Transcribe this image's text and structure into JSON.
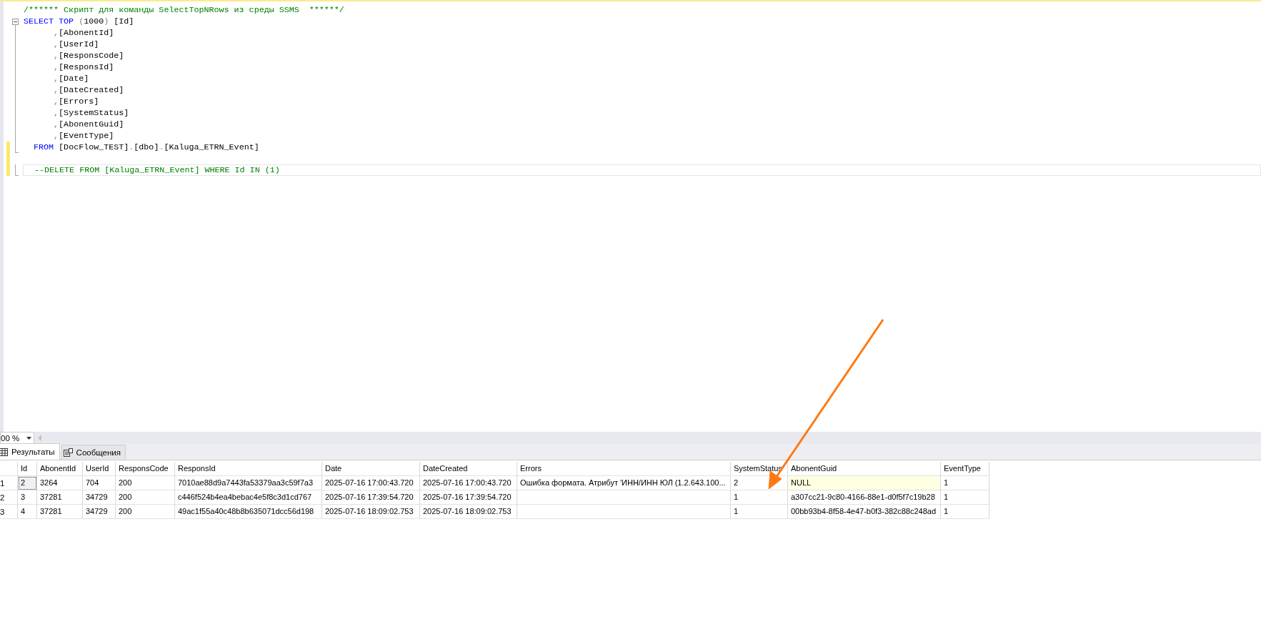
{
  "editor": {
    "lines": [
      {
        "changed": false,
        "current": false,
        "kind": "none",
        "tokens": [
          {
            "kind": "comment",
            "text": "/****** Скрипт для команды SelectTopNRows из среды SSMS  ******/"
          }
        ]
      },
      {
        "changed": false,
        "current": false,
        "kind": "start",
        "tokens": [
          {
            "kind": "keyword",
            "text": "SELECT TOP "
          },
          {
            "kind": "punct",
            "text": "("
          },
          {
            "kind": "plain",
            "text": "1000"
          },
          {
            "kind": "punct",
            "text": ")"
          },
          {
            "kind": "plain",
            "text": " [Id]"
          }
        ]
      },
      {
        "changed": false,
        "current": false,
        "kind": "inside",
        "tokens": [
          {
            "kind": "punct",
            "text": "      ,"
          },
          {
            "kind": "plain",
            "text": "[AbonentId]"
          }
        ]
      },
      {
        "changed": false,
        "current": false,
        "kind": "inside",
        "tokens": [
          {
            "kind": "punct",
            "text": "      ,"
          },
          {
            "kind": "plain",
            "text": "[UserId]"
          }
        ]
      },
      {
        "changed": false,
        "current": false,
        "kind": "inside",
        "tokens": [
          {
            "kind": "punct",
            "text": "      ,"
          },
          {
            "kind": "plain",
            "text": "[ResponsCode]"
          }
        ]
      },
      {
        "changed": false,
        "current": false,
        "kind": "inside",
        "tokens": [
          {
            "kind": "punct",
            "text": "      ,"
          },
          {
            "kind": "plain",
            "text": "[ResponsId]"
          }
        ]
      },
      {
        "changed": false,
        "current": false,
        "kind": "inside",
        "tokens": [
          {
            "kind": "punct",
            "text": "      ,"
          },
          {
            "kind": "plain",
            "text": "[Date]"
          }
        ]
      },
      {
        "changed": false,
        "current": false,
        "kind": "inside",
        "tokens": [
          {
            "kind": "punct",
            "text": "      ,"
          },
          {
            "kind": "plain",
            "text": "[DateCreated]"
          }
        ]
      },
      {
        "changed": false,
        "current": false,
        "kind": "inside",
        "tokens": [
          {
            "kind": "punct",
            "text": "      ,"
          },
          {
            "kind": "plain",
            "text": "[Errors]"
          }
        ]
      },
      {
        "changed": false,
        "current": false,
        "kind": "inside",
        "tokens": [
          {
            "kind": "punct",
            "text": "      ,"
          },
          {
            "kind": "plain",
            "text": "[SystemStatus]"
          }
        ]
      },
      {
        "changed": false,
        "current": false,
        "kind": "inside",
        "tokens": [
          {
            "kind": "punct",
            "text": "      ,"
          },
          {
            "kind": "plain",
            "text": "[AbonentGuid]"
          }
        ]
      },
      {
        "changed": false,
        "current": false,
        "kind": "inside",
        "tokens": [
          {
            "kind": "punct",
            "text": "      ,"
          },
          {
            "kind": "plain",
            "text": "[EventType]"
          }
        ]
      },
      {
        "changed": true,
        "current": false,
        "kind": "end",
        "tokens": [
          {
            "kind": "keyword",
            "text": "  FROM "
          },
          {
            "kind": "plain",
            "text": "[DocFlow_TEST]"
          },
          {
            "kind": "punct",
            "text": "."
          },
          {
            "kind": "plain",
            "text": "[dbo]"
          },
          {
            "kind": "punct",
            "text": "."
          },
          {
            "kind": "plain",
            "text": "[Kaluga_ETRN_Event]"
          }
        ]
      },
      {
        "changed": true,
        "kind": "none"
      },
      {
        "changed": true,
        "current": true,
        "kind": "single",
        "tokens": [
          {
            "kind": "comment",
            "text": "  --DELETE FROM [Kaluga_ETRN_Event] WHERE Id IN (1)"
          }
        ]
      }
    ]
  },
  "zoom": {
    "value": "00 %"
  },
  "tabs": [
    {
      "label": "Результаты",
      "selected": true
    },
    {
      "label": "Сообщения",
      "selected": false
    }
  ],
  "grid": {
    "columns": [
      "Id",
      "AbonentId",
      "UserId",
      "ResponsCode",
      "ResponsId",
      "Date",
      "DateCreated",
      "Errors",
      "SystemStatus",
      "AbonentGuid",
      "EventType"
    ],
    "rows": [
      {
        "number": "1",
        "cells": [
          {
            "text": "2",
            "selected": true,
            "null": false
          },
          {
            "text": "3264",
            "selected": false,
            "null": false
          },
          {
            "text": "704",
            "selected": false,
            "null": false
          },
          {
            "text": "200",
            "selected": false,
            "null": false
          },
          {
            "text": "7010ae88d9a7443fa53379aa3c59f7a3",
            "selected": false,
            "null": false
          },
          {
            "text": "2025-07-16 17:00:43.720",
            "selected": false,
            "null": false
          },
          {
            "text": "2025-07-16 17:00:43.720",
            "selected": false,
            "null": false
          },
          {
            "text": "Ошибка формата. Атрибут 'ИНН/ИНН ЮЛ (1.2.643.100...",
            "selected": false,
            "null": false
          },
          {
            "text": "2",
            "selected": false,
            "null": false
          },
          {
            "text": "NULL",
            "selected": false,
            "null": true
          },
          {
            "text": "1",
            "selected": false,
            "null": false
          }
        ]
      },
      {
        "number": "2",
        "cells": [
          {
            "text": "3",
            "selected": false,
            "null": false
          },
          {
            "text": "37281",
            "selected": false,
            "null": false
          },
          {
            "text": "34729",
            "selected": false,
            "null": false
          },
          {
            "text": "200",
            "selected": false,
            "null": false
          },
          {
            "text": "c446f524b4ea4bebac4e5f8c3d1cd767",
            "selected": false,
            "null": false
          },
          {
            "text": "2025-07-16 17:39:54.720",
            "selected": false,
            "null": false
          },
          {
            "text": "2025-07-16 17:39:54.720",
            "selected": false,
            "null": false
          },
          {
            "text": "",
            "selected": false,
            "null": false
          },
          {
            "text": "1",
            "selected": false,
            "null": false
          },
          {
            "text": "a307cc21-9c80-4166-88e1-d0f5f7c19b28",
            "selected": false,
            "null": false
          },
          {
            "text": "1",
            "selected": false,
            "null": false
          }
        ]
      },
      {
        "number": "3",
        "cells": [
          {
            "text": "4",
            "selected": false,
            "null": false
          },
          {
            "text": "37281",
            "selected": false,
            "null": false
          },
          {
            "text": "34729",
            "selected": false,
            "null": false
          },
          {
            "text": "200",
            "selected": false,
            "null": false
          },
          {
            "text": "49ac1f55a40c48b8b635071dcc56d198",
            "selected": false,
            "null": false
          },
          {
            "text": "2025-07-16 18:09:02.753",
            "selected": false,
            "null": false
          },
          {
            "text": "2025-07-16 18:09:02.753",
            "selected": false,
            "null": false
          },
          {
            "text": "",
            "selected": false,
            "null": false
          },
          {
            "text": "1",
            "selected": false,
            "null": false
          },
          {
            "text": "00bb93b4-8f58-4e47-b0f3-382c88c248ad",
            "selected": false,
            "null": false
          },
          {
            "text": "1",
            "selected": false,
            "null": false
          }
        ]
      }
    ]
  }
}
